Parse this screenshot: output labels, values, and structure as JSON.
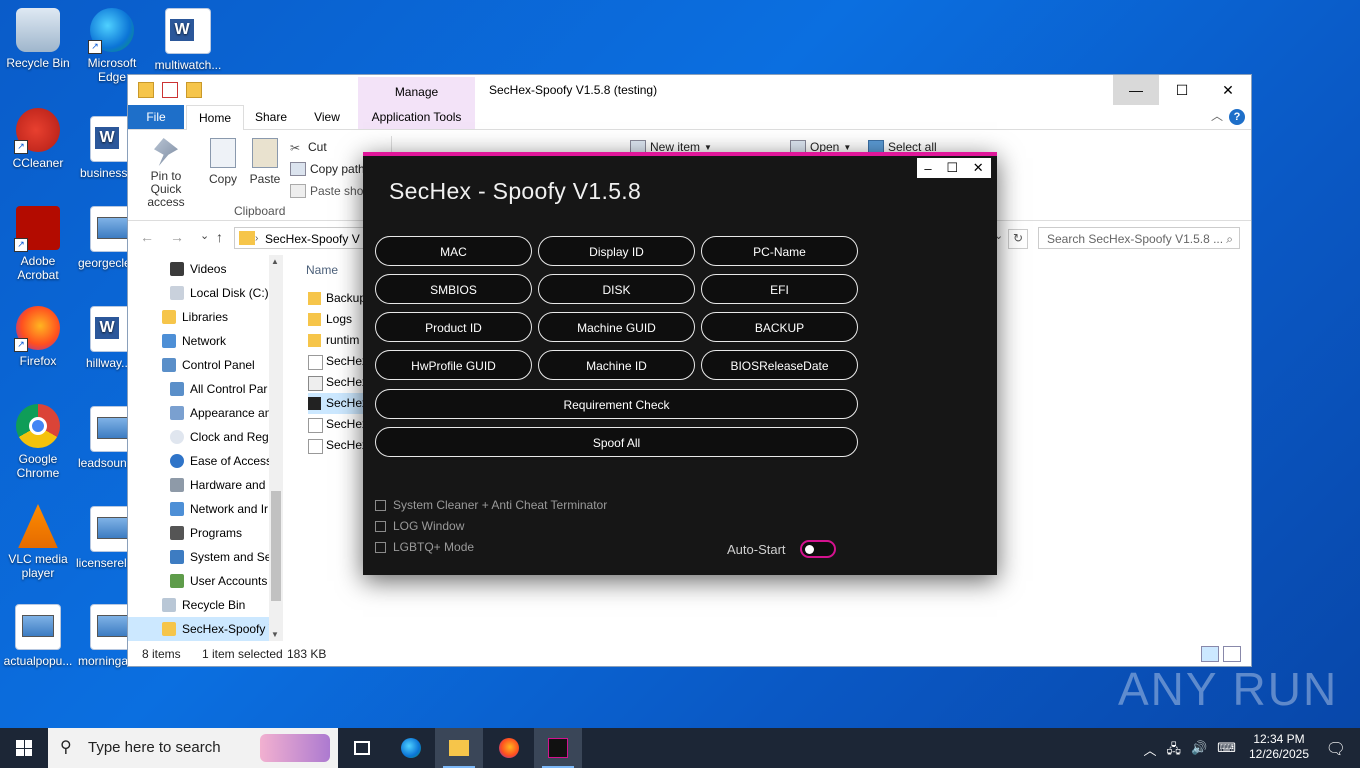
{
  "desktop": {
    "icons": [
      {
        "label": "Recycle Bin"
      },
      {
        "label": "Microsoft Edge"
      },
      {
        "label": "multiwatch..."
      },
      {
        "label": "CCleaner"
      },
      {
        "label": "business..."
      },
      {
        "label": "Adobe Acrobat"
      },
      {
        "label": "georgecle..."
      },
      {
        "label": "Firefox"
      },
      {
        "label": "hillway..."
      },
      {
        "label": "Google Chrome"
      },
      {
        "label": "leadsoun..."
      },
      {
        "label": "VLC media player"
      },
      {
        "label": "licenserel..."
      },
      {
        "label": "actualpopu..."
      },
      {
        "label": "morningar..."
      }
    ]
  },
  "explorer": {
    "title": "SecHex-Spoofy V1.5.8 (testing)",
    "manage_label": "Manage",
    "tabs": {
      "file": "File",
      "home": "Home",
      "share": "Share",
      "view": "View",
      "app_tools": "Application Tools"
    },
    "ribbon": {
      "pin": "Pin to Quick access",
      "copy": "Copy",
      "paste": "Paste",
      "cut": "Cut",
      "copy_path": "Copy path",
      "paste_shortcut": "Paste short",
      "clipboard": "Clipboard",
      "new_item": "New item",
      "open": "Open",
      "select_all": "Select all"
    },
    "address": "SecHex-Spoofy V",
    "search_placeholder": "Search SecHex-Spoofy V1.5.8 ...",
    "nav": [
      {
        "label": "Videos"
      },
      {
        "label": "Local Disk (C:)"
      },
      {
        "label": "Libraries"
      },
      {
        "label": "Network"
      },
      {
        "label": "Control Panel"
      },
      {
        "label": "All Control Par"
      },
      {
        "label": "Appearance an"
      },
      {
        "label": "Clock and Regi"
      },
      {
        "label": "Ease of Access"
      },
      {
        "label": "Hardware and"
      },
      {
        "label": "Network and Ir"
      },
      {
        "label": "Programs"
      },
      {
        "label": "System and Se"
      },
      {
        "label": "User Accounts"
      },
      {
        "label": "Recycle Bin"
      },
      {
        "label": "SecHex-Spoofy V"
      }
    ],
    "column_name": "Name",
    "files": [
      {
        "label": "Backup"
      },
      {
        "label": "Logs"
      },
      {
        "label": "runtim"
      },
      {
        "label": "SecHex"
      },
      {
        "label": "SecHex"
      },
      {
        "label": "SecHex"
      },
      {
        "label": "SecHex"
      },
      {
        "label": "SecHex"
      }
    ],
    "status": {
      "items": "8 items",
      "selected": "1 item selected",
      "size": "183 KB"
    }
  },
  "spoofy": {
    "title": "SecHex - Spoofy V1.5.8",
    "buttons": {
      "mac": "MAC",
      "display_id": "Display ID",
      "pc_name": "PC-Name",
      "smbios": "SMBIOS",
      "disk": "DISK",
      "efi": "EFI",
      "product_id": "Product ID",
      "machine_guid": "Machine GUID",
      "backup": "BACKUP",
      "hwprofile_guid": "HwProfile GUID",
      "machine_id": "Machine ID",
      "bios_release_date": "BIOSReleaseDate",
      "requirement_check": "Requirement Check",
      "spoof_all": "Spoof All"
    },
    "checkboxes": {
      "cleaner": "System Cleaner + Anti Cheat Terminator",
      "log_window": "LOG Window",
      "lgbtq_mode": "LGBTQ+ Mode"
    },
    "auto_start_label": "Auto-Start",
    "auto_start_on": false
  },
  "taskbar": {
    "search_placeholder": "Type here to search",
    "time": "12:34 PM",
    "date": "12/26/2025"
  },
  "watermark": "ANY RUN"
}
